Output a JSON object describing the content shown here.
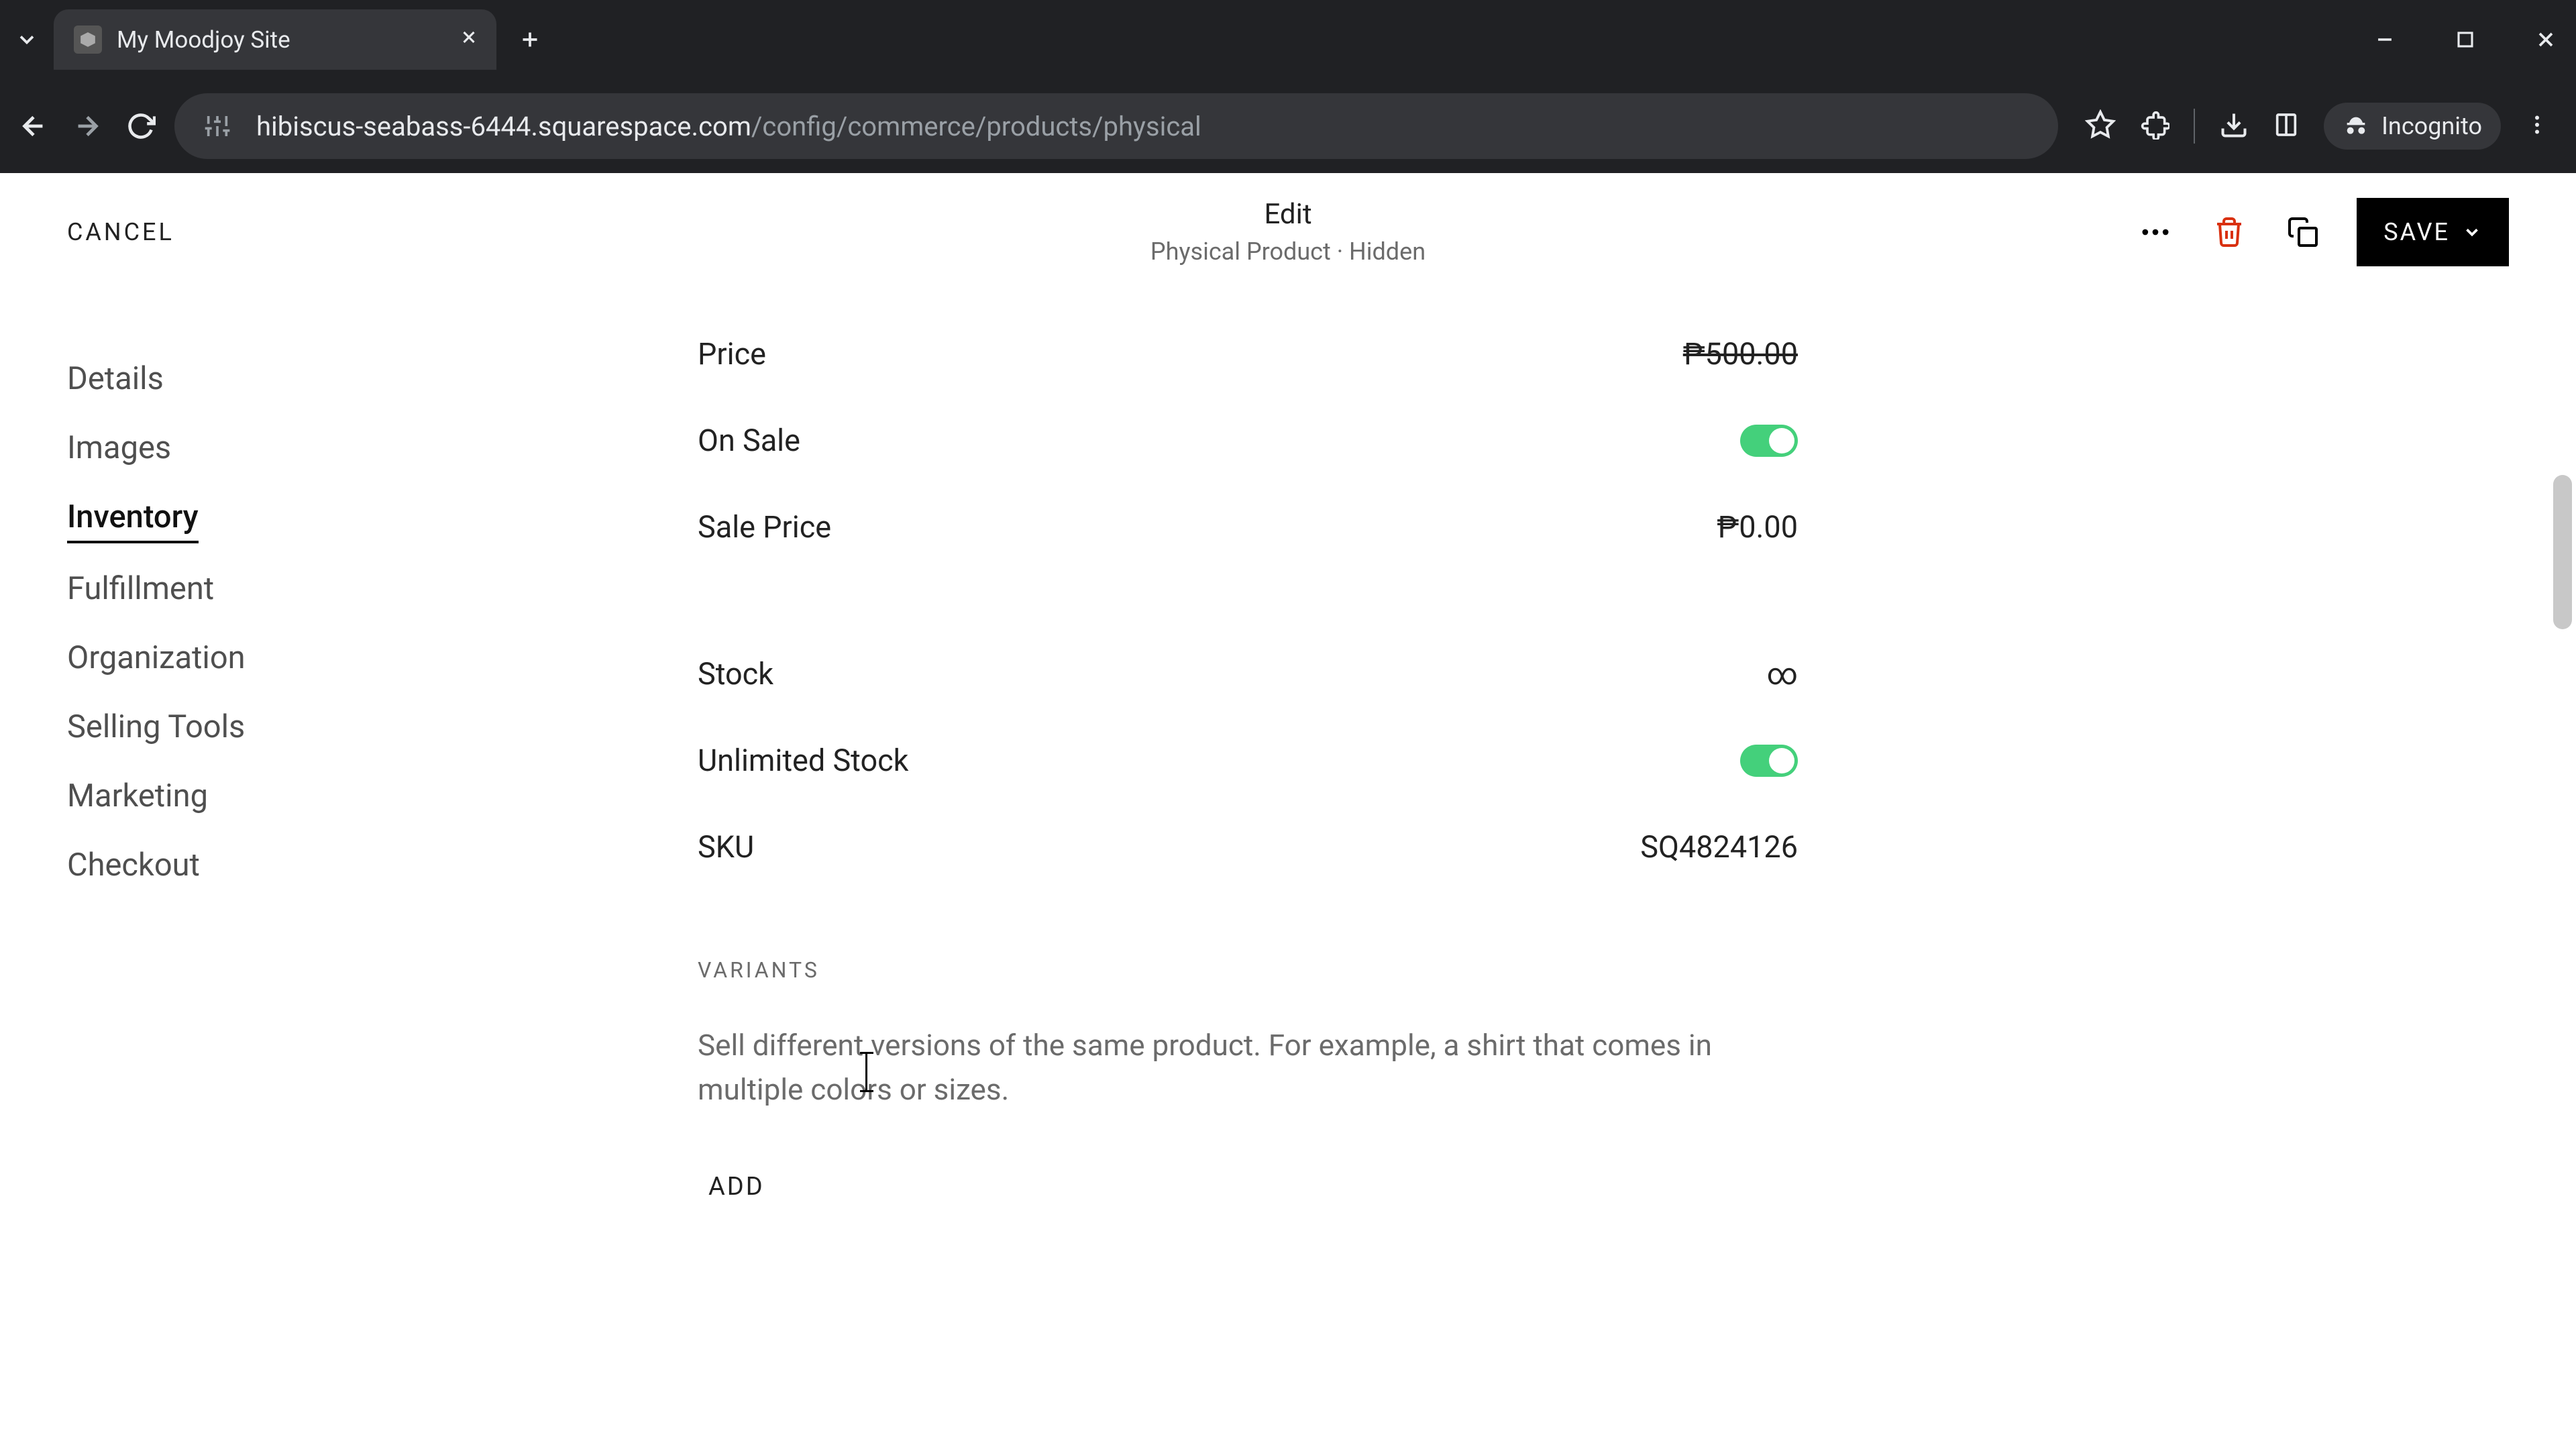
{
  "browser": {
    "tab_title": "My Moodjoy Site",
    "url_host": "hibiscus-seabass-6444.squarespace.com",
    "url_path": "/config/commerce/products/physical",
    "incognito_label": "Incognito"
  },
  "header": {
    "cancel": "CANCEL",
    "title": "Edit",
    "subtitle": "Physical Product · Hidden",
    "save": "SAVE"
  },
  "sidebar": {
    "items": [
      {
        "label": "Details",
        "active": false
      },
      {
        "label": "Images",
        "active": false
      },
      {
        "label": "Inventory",
        "active": true
      },
      {
        "label": "Fulfillment",
        "active": false
      },
      {
        "label": "Organization",
        "active": false
      },
      {
        "label": "Selling Tools",
        "active": false
      },
      {
        "label": "Marketing",
        "active": false
      },
      {
        "label": "Checkout",
        "active": false
      }
    ]
  },
  "inventory": {
    "price_label": "Price",
    "price_value": "₱500.00",
    "on_sale_label": "On Sale",
    "on_sale": true,
    "sale_price_label": "Sale Price",
    "sale_price_value": "₱0.00",
    "stock_label": "Stock",
    "stock_value": "∞",
    "unlimited_stock_label": "Unlimited Stock",
    "unlimited_stock": true,
    "sku_label": "SKU",
    "sku_value": "SQ4824126"
  },
  "variants": {
    "heading": "VARIANTS",
    "description": "Sell different versions of the same product. For example, a shirt that comes in multiple colors or sizes.",
    "add_label": "ADD"
  },
  "colors": {
    "toggle_on": "#44d07b",
    "danger": "#d9300f"
  }
}
